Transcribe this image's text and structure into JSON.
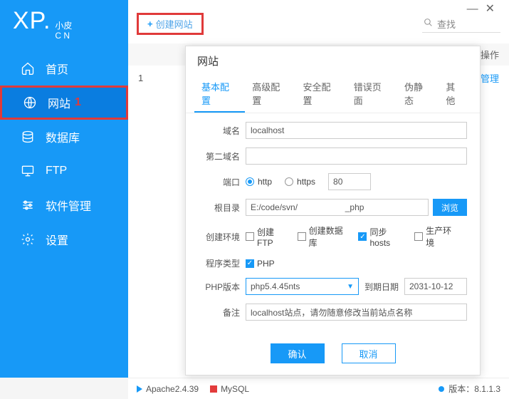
{
  "logo": {
    "main": "XP.",
    "top": "小皮",
    "bottom": "C N"
  },
  "nav": {
    "home": "首页",
    "site": "网站",
    "site_num": "1",
    "database": "数据库",
    "ftp": "FTP",
    "software": "软件管理",
    "settings": "设置"
  },
  "window": {
    "min": "—",
    "close": "✕"
  },
  "toolbar": {
    "create": "创建网站",
    "search": "查找"
  },
  "table": {
    "op_header": "操作",
    "row1_idx": "1",
    "manage": "管理"
  },
  "dialog": {
    "title": "网站",
    "tabs": {
      "basic": "基本配置",
      "advanced": "高级配置",
      "security": "安全配置",
      "error": "错误页面",
      "rewrite": "伪静态",
      "other": "其他"
    },
    "labels": {
      "domain": "域名",
      "second_domain": "第二域名",
      "port": "端口",
      "root": "根目录",
      "create_env": "创建环境",
      "prog_type": "程序类型",
      "php_version": "PHP版本",
      "expire": "到期日期",
      "remark": "备注"
    },
    "values": {
      "domain": "localhost",
      "http": "http",
      "https": "https",
      "port_value": "80",
      "root": "E:/code/svn/                    _php",
      "browse": "浏览",
      "create_ftp": "创建FTP",
      "create_db": "创建数据库",
      "sync_hosts": "同步hosts",
      "prod_env": "生产环境",
      "php": "PHP",
      "php_version": "php5.4.45nts",
      "expire": "2031-10-12",
      "remark": "localhost站点，请勿随意修改当前站点名称",
      "ok": "确认",
      "cancel": "取消"
    }
  },
  "status": {
    "apache": "Apache2.4.39",
    "mysql": "MySQL",
    "version_label": "版本：",
    "version": "8.1.1.3"
  }
}
